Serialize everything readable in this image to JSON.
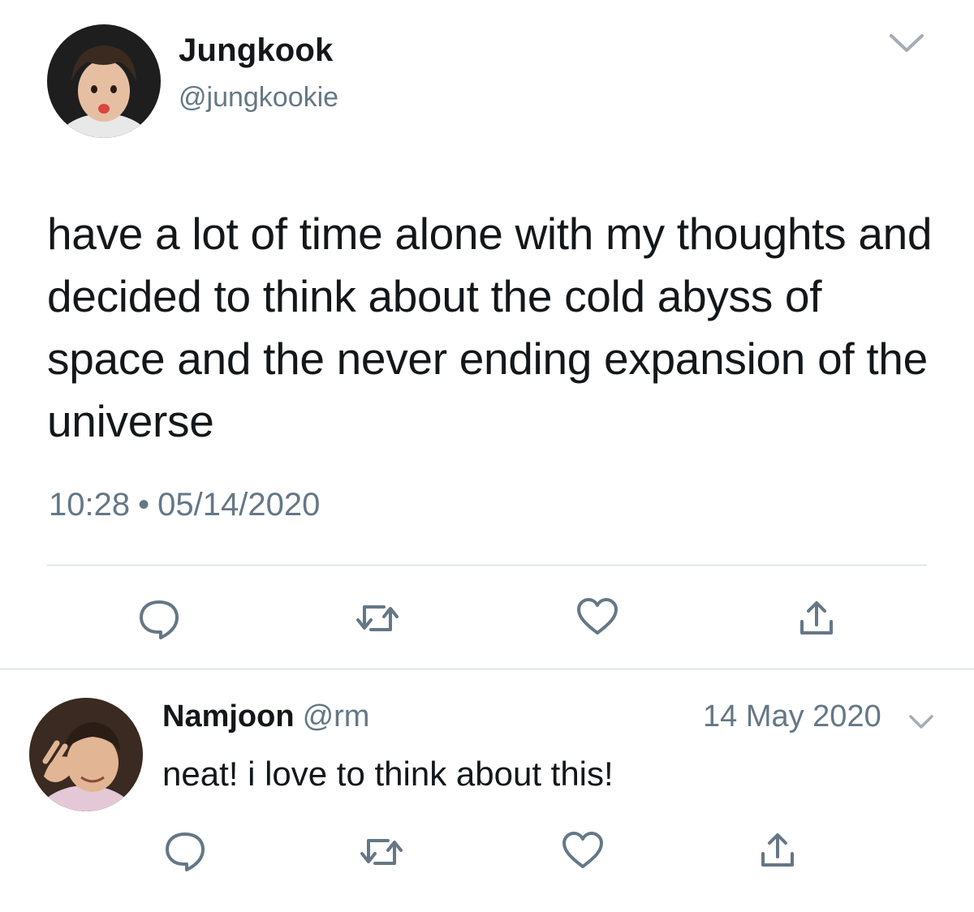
{
  "main_tweet": {
    "author_name": "Jungkook",
    "author_handle": "@jungkookie",
    "text": "have a lot of time alone with my thoughts and decided to think about the cold abyss of space and the never ending expansion of the universe",
    "time": "10:28",
    "separator": "•",
    "date": "05/14/2020",
    "actions": [
      "reply-icon",
      "retweet-icon",
      "like-icon",
      "share-icon"
    ]
  },
  "reply_tweet": {
    "author_name": "Namjoon",
    "author_handle": "@rm",
    "date": "14 May 2020",
    "text": "neat! i love to think about this!",
    "actions": [
      "reply-icon",
      "retweet-icon",
      "like-icon",
      "share-icon"
    ]
  },
  "colors": {
    "text": "#14171a",
    "secondary": "#657786",
    "icon": "#657786",
    "divider": "#cfd5da"
  }
}
